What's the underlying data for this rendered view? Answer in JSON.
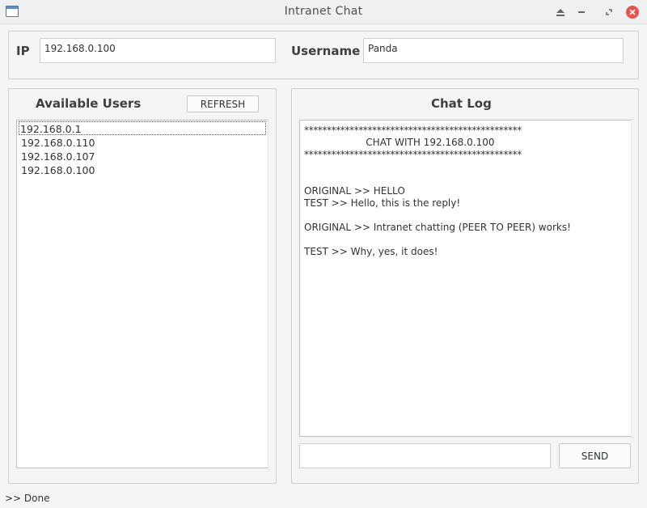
{
  "window": {
    "title": "Intranet Chat",
    "icon": "window-icon",
    "controls": [
      "shade-icon",
      "minimize-icon",
      "maximize-icon",
      "close-icon"
    ]
  },
  "connection": {
    "ip_label": "IP",
    "ip_value": "192.168.0.100",
    "username_label": "Username",
    "username_value": "Panda"
  },
  "users": {
    "heading": "Available Users",
    "refresh_label": "REFRESH",
    "items": [
      "192.168.0.1",
      "192.168.0.110",
      "192.168.0.107",
      "192.168.0.100"
    ]
  },
  "chat": {
    "heading": "Chat Log",
    "lines": [
      "************************************************",
      "                    CHAT WITH 192.168.0.100",
      "************************************************",
      "",
      "",
      "ORIGINAL >> HELLO",
      "TEST >> Hello, this is the reply!",
      "",
      "ORIGINAL >> Intranet chatting (PEER TO PEER) works!",
      "",
      "TEST >> Why, yes, it does!"
    ],
    "message_value": "",
    "send_label": "SEND"
  },
  "status": {
    "text": ">> Done"
  },
  "colors": {
    "close_button": "#e8534c",
    "background": "#f4f5f6"
  }
}
